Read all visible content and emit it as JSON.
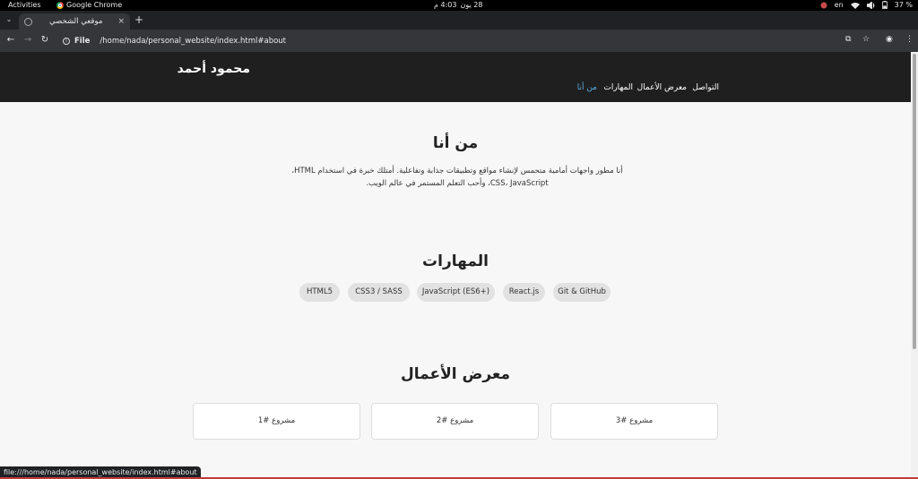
{
  "system_bar": {
    "activities": "Activities",
    "app_name": "Google Chrome",
    "date": "28 يون",
    "time": "4:03 م",
    "language": "en",
    "battery": "37 %"
  },
  "browser": {
    "tab_title": "موقعي الشخصي",
    "new_tab": "+",
    "tab_menu": "⌄",
    "close_tab": "×",
    "scheme_label": "File",
    "url": "/home/nada/personal_website/index.html#about",
    "status_url": "file:///home/nada/personal_website/index.html#about"
  },
  "site": {
    "brand": "محمود أحمد",
    "nav": [
      {
        "label": "من أنا",
        "active": true
      },
      {
        "label": "المهارات",
        "active": false
      },
      {
        "label": "معرض الأعمال",
        "active": false
      },
      {
        "label": "التواصل",
        "active": false
      }
    ],
    "about": {
      "title": "من أنا",
      "line1": "أنا مطور واجهات أمامية متحمس لإنشاء مواقع وتطبيقات جذابة وتفاعلية. أمتلك خبرة في استخدام HTML،",
      "line2": "CSS، JavaScript، وأحب التعلم المستمر في عالم الويب."
    },
    "skills": {
      "title": "المهارات",
      "items": [
        "HTML5",
        "CSS3 / SASS",
        "JavaScript (ES6+)",
        "React.js",
        "Git & GitHub"
      ]
    },
    "portfolio": {
      "title": "معرض الأعمال",
      "projects": [
        "مشروع #1",
        "مشروع #2",
        "مشروع #3"
      ]
    }
  },
  "colors": {
    "header_bg": "#1f1f1f",
    "active_link": "#5dade2",
    "page_bg": "#f7f7f7"
  }
}
